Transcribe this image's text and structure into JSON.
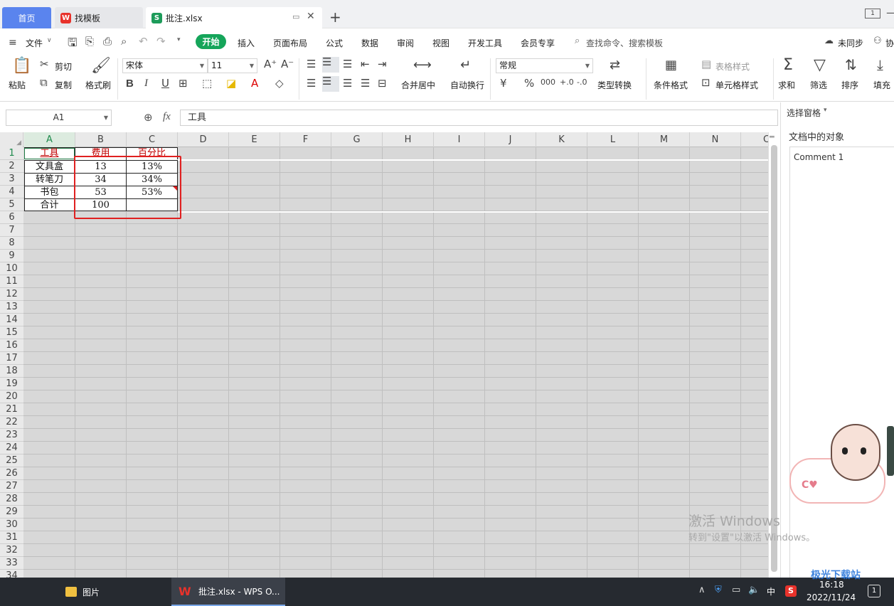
{
  "tabs": {
    "home": "首页",
    "template": "找模板",
    "file": "批注.xlsx"
  },
  "menu": {
    "file": "文件",
    "start": "开始",
    "insert": "插入",
    "layout": "页面布局",
    "formula": "公式",
    "data": "数据",
    "review": "审阅",
    "view": "视图",
    "dev": "开发工具",
    "member": "会员专享",
    "search": "查找命令、搜索模板",
    "sync": "未同步",
    "collab": "协"
  },
  "ribbon": {
    "paste": "粘贴",
    "cut": "剪切",
    "copy": "复制",
    "format_painter": "格式刷",
    "font_name": "宋体",
    "font_size": "11",
    "merge": "合并居中",
    "wrap": "自动换行",
    "number_format": "常规",
    "type_convert": "类型转换",
    "cond_format": "条件格式",
    "table_style": "表格样式",
    "cell_style": "单元格样式",
    "sum": "求和",
    "filter": "筛选",
    "sort": "排序",
    "fill": "填充",
    "bold": "B",
    "italic": "I",
    "underline": "U"
  },
  "formula_bar": {
    "cell_ref": "A1",
    "fx": "fx",
    "value": "工具"
  },
  "columns": [
    "A",
    "B",
    "C",
    "D",
    "E",
    "F",
    "G",
    "H",
    "I",
    "J",
    "K",
    "L",
    "M",
    "N",
    "C"
  ],
  "rows": [
    "1",
    "2",
    "3",
    "4",
    "5",
    "6",
    "7",
    "8",
    "9",
    "10",
    "11",
    "12",
    "13",
    "14",
    "15",
    "16",
    "17",
    "18",
    "19",
    "20",
    "21",
    "22",
    "23",
    "24",
    "25",
    "26",
    "27",
    "28",
    "29",
    "30",
    "31",
    "32",
    "33",
    "34"
  ],
  "table": {
    "headers": [
      "工具",
      "费用",
      "百分比"
    ],
    "rows": [
      [
        "文具盒",
        "13",
        "13%"
      ],
      [
        "转笔刀",
        "34",
        "34%"
      ],
      [
        "书包",
        "53",
        "53%"
      ],
      [
        "合计",
        "100",
        ""
      ]
    ]
  },
  "panel": {
    "title": "选择窗格",
    "section": "文档中的对象",
    "item": "Comment 1"
  },
  "watermark": {
    "line1": "激活 Windows",
    "line2": "转到\"设置\"以激活 Windows。"
  },
  "taskbar": {
    "folder": "图片",
    "wps": "批注.xlsx - WPS O...",
    "ime": "中",
    "time": "16:18",
    "date": "2022/11/24",
    "notif": "1"
  },
  "brand": "极光下载站"
}
